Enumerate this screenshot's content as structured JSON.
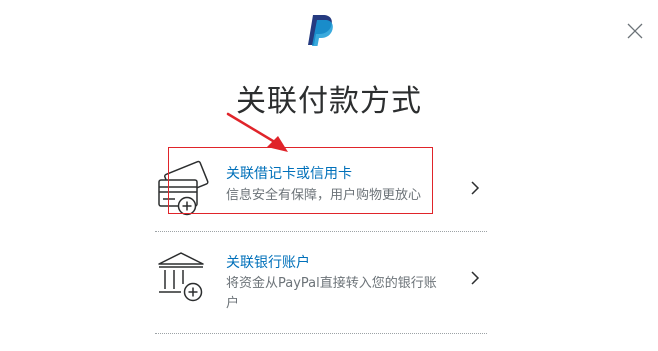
{
  "dialog": {
    "title": "关联付款方式"
  },
  "options": [
    {
      "heading": "关联借记卡或信用卡",
      "description": "信息安全有保障，用户购物更放心",
      "icon": "credit-card-add-icon"
    },
    {
      "heading": "关联银行账户",
      "description": "将资金从PayPal直接转入您的银行账户",
      "icon": "bank-add-icon"
    }
  ],
  "icons": {
    "logo": "paypal-logo",
    "close": "close-icon",
    "chevron": "chevron-right-icon"
  },
  "annotation": {
    "highlight": "red-box",
    "pointer": "red-arrow"
  },
  "colors": {
    "accent_link": "#0070ba",
    "paypal_dark": "#253b80",
    "paypal_light": "#179bd7",
    "annotation_red": "#e0242a",
    "muted_text": "#6c7378"
  }
}
